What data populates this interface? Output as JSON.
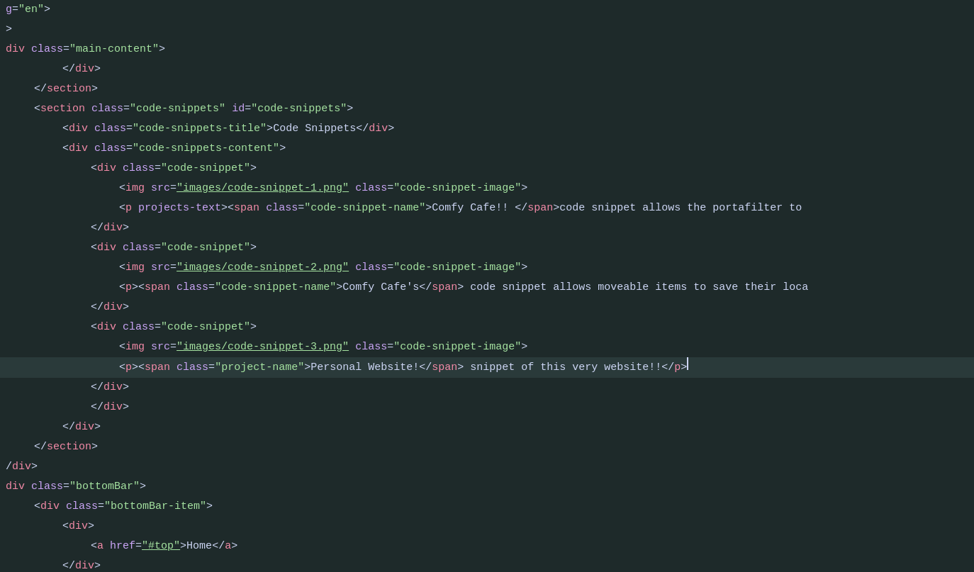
{
  "editor": {
    "background": "#1e2a2a",
    "lines": [
      {
        "indent": 0,
        "content": "g=\"en\">",
        "highlighted": false
      },
      {
        "indent": 0,
        "content": ">",
        "highlighted": false
      },
      {
        "indent": 0,
        "content": "div class=\"main-content\">",
        "highlighted": false
      },
      {
        "indent": 2,
        "content": "</div>",
        "highlighted": false
      },
      {
        "indent": 1,
        "content": "</section>",
        "highlighted": false
      },
      {
        "indent": 1,
        "content": "<section class=\"code-snippets\" id=\"code-snippets\">",
        "highlighted": false
      },
      {
        "indent": 2,
        "content": "<div class=\"code-snippets-title\">Code Snippets</div>",
        "highlighted": false
      },
      {
        "indent": 2,
        "content": "<div class=\"code-snippets-content\">",
        "highlighted": false
      },
      {
        "indent": 3,
        "content": "<div class=\"code-snippet\">",
        "highlighted": false
      },
      {
        "indent": 4,
        "content": "<img src=\"images/code-snippet-1.png\" class=\"code-snippet-image\">",
        "highlighted": false
      },
      {
        "indent": 4,
        "content": "<p projects-text><span class=\"code-snippet-name\">Comfy Cafe!! </span>code snippet allows the portafilter to",
        "highlighted": false
      },
      {
        "indent": 3,
        "content": "</div>",
        "highlighted": false
      },
      {
        "indent": 3,
        "content": "<div class=\"code-snippet\">",
        "highlighted": false
      },
      {
        "indent": 4,
        "content": "<img src=\"images/code-snippet-2.png\" class=\"code-snippet-image\">",
        "highlighted": false
      },
      {
        "indent": 4,
        "content": "<p><span class=\"code-snippet-name\">Comfy Cafe's</span> code snippet allows moveable items to save their loca",
        "highlighted": false
      },
      {
        "indent": 3,
        "content": "</div>",
        "highlighted": false
      },
      {
        "indent": 3,
        "content": "<div class=\"code-snippet\">",
        "highlighted": false
      },
      {
        "indent": 4,
        "content": "<img src=\"images/code-snippet-3.png\" class=\"code-snippet-image\">",
        "highlighted": false
      },
      {
        "indent": 4,
        "content": "<p><span class=\"project-name\">Personal Website!</span> snippet of this very website!!",
        "highlighted": true
      },
      {
        "indent": 3,
        "content": "</div>",
        "highlighted": false
      },
      {
        "indent": 3,
        "content": "</div>",
        "highlighted": false
      },
      {
        "indent": 2,
        "content": "</div>",
        "highlighted": false
      },
      {
        "indent": 1,
        "content": "</section>",
        "highlighted": false
      },
      {
        "indent": 0,
        "content": "/div>",
        "highlighted": false
      },
      {
        "indent": 0,
        "content": "div class=\"bottomBar\">",
        "highlighted": false
      },
      {
        "indent": 1,
        "content": "<div class=\"bottomBar-item\">",
        "highlighted": false
      },
      {
        "indent": 2,
        "content": "<div>",
        "highlighted": false
      },
      {
        "indent": 3,
        "content": "<a href=\"#top\">Home</a>",
        "highlighted": false
      },
      {
        "indent": 2,
        "content": "</div>",
        "highlighted": false
      },
      {
        "indent": 1,
        "content": "</div>",
        "highlighted": false
      }
    ]
  }
}
